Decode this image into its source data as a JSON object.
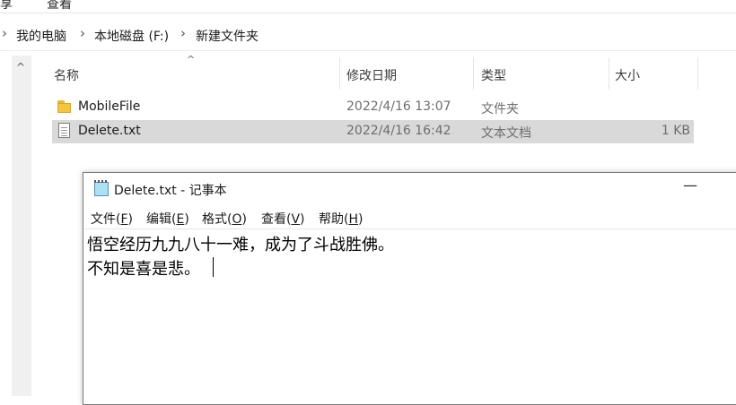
{
  "ribbon": {
    "left_text": "享",
    "right_text": "查看"
  },
  "breadcrumb": {
    "items": [
      "我的电脑",
      "本地磁盘 (F:)",
      "新建文件夹"
    ],
    "separator": "›"
  },
  "columns": {
    "name": "名称",
    "date": "修改日期",
    "type": "类型",
    "size": "大小"
  },
  "files": [
    {
      "name": "MobileFile",
      "date": "2022/4/16 13:07",
      "type": "文件夹",
      "size": "",
      "icon": "folder-icon",
      "selected": false
    },
    {
      "name": "Delete.txt",
      "date": "2022/4/16 16:42",
      "type": "文本文档",
      "size": "1 KB",
      "icon": "text-file-icon",
      "selected": true
    }
  ],
  "notepad": {
    "title": "Delete.txt - 记事本",
    "minimize": "—",
    "menu": [
      {
        "label": "文件",
        "key": "F"
      },
      {
        "label": "编辑",
        "key": "E"
      },
      {
        "label": "格式",
        "key": "O"
      },
      {
        "label": "查看",
        "key": "V"
      },
      {
        "label": "帮助",
        "key": "H"
      }
    ],
    "content": [
      "悟空经历九九八十一难，成为了斗战胜佛。",
      "不知是喜是悲。"
    ]
  },
  "colors": {
    "selected_row": "#d9d9d9",
    "folder": "#f4c542",
    "notepad_icon": "#aee0f5"
  }
}
